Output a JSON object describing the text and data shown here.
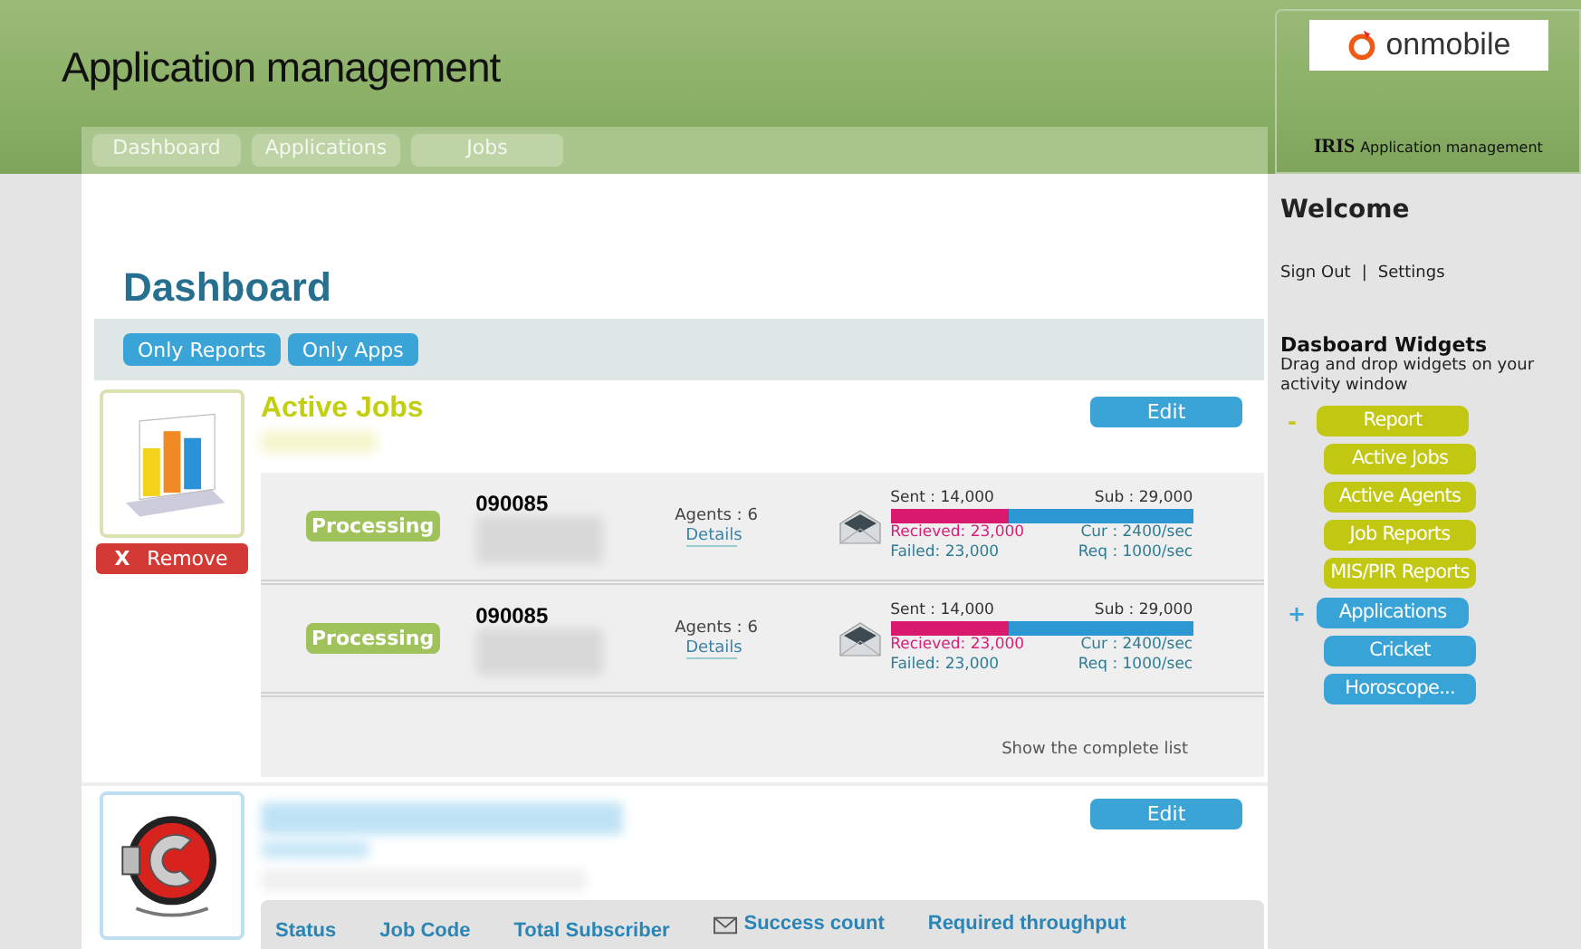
{
  "header": {
    "title": "Application management",
    "nav": [
      {
        "label": "Dashboard"
      },
      {
        "label": "Applications"
      },
      {
        "label": "Jobs"
      }
    ],
    "brand": {
      "logo": "onmobile",
      "product": "IRIS",
      "subtitle": "Application management"
    }
  },
  "page_title": "Dashboard",
  "filters": [
    {
      "label": "Only Reports"
    },
    {
      "label": "Only Apps"
    }
  ],
  "widgets": [
    {
      "kind": "jobs",
      "title": "Active Jobs",
      "remove_icon": "X",
      "remove_label": "Remove",
      "edit_label": "Edit",
      "footer_link": "Show the complete list",
      "jobs": [
        {
          "status": "Processing",
          "code": "090085",
          "agents": "Agents : 6",
          "details": "Details",
          "sent": "Sent : 14,000",
          "sub": "Sub : 29,000",
          "level": 0.39,
          "received": "Recieved: 23,000",
          "failed": "Failed: 23,000",
          "cur": "Cur : 2400/sec",
          "req": "Req : 1000/sec"
        },
        {
          "status": "Processing",
          "code": "090085",
          "agents": "Agents : 6",
          "details": "Details",
          "sent": "Sent : 14,000",
          "sub": "Sub : 29,000",
          "level": 0.39,
          "received": "Recieved: 23,000",
          "failed": "Failed: 23,000",
          "cur": "Cur : 2400/sec",
          "req": "Req : 1000/sec"
        }
      ]
    },
    {
      "kind": "stats",
      "edit_label": "Edit",
      "columns": [
        "Status",
        "Job Code",
        "Total Subscriber",
        "Success count",
        "Required throughput"
      ]
    }
  ],
  "sidebar": {
    "welcome": "Welcome",
    "links": [
      {
        "label": "Sign Out"
      },
      {
        "label": "Settings"
      }
    ],
    "separator": "|",
    "widgets_title": "Dasboard Widgets",
    "widgets_hint": "Drag and drop widgets on your activity window",
    "tree": [
      {
        "marker": "-",
        "label": "Report",
        "color": "#c2c712",
        "children": [
          {
            "label": "Active Jobs"
          },
          {
            "label": "Active Agents"
          },
          {
            "label": "Job Reports"
          },
          {
            "label": "MIS/PIR Reports"
          }
        ]
      },
      {
        "marker": "+",
        "label": "Applications",
        "color": "#37a3d6",
        "children": [
          {
            "label": "Cricket"
          },
          {
            "label": "Horoscope..."
          }
        ]
      }
    ]
  }
}
